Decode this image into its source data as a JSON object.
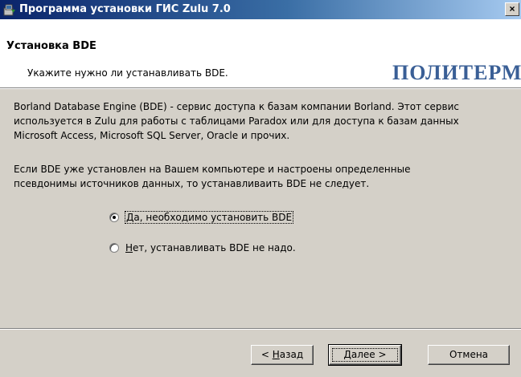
{
  "window": {
    "title": "Программа установки ГИС Zulu 7.0",
    "close_label": "×"
  },
  "header": {
    "title": "Установка BDE",
    "subtitle": "Укажите нужно ли устанавливать BDE.",
    "logo_text": "ПОЛИТЕРМ"
  },
  "content": {
    "paragraph1": "Borland Database Engine (BDE) - сервис доступа к базам компании Borland. Этот сервис используется в Zulu для работы с таблицами Paradox или для доступа к базам данных Microsoft Access, Microsoft SQL Server, Oracle и прочих.",
    "paragraph2": "Если BDE уже установлен на Вашем компьютере и настроены определенные псевдонимы источников данных, то устанавливаить BDE не следует."
  },
  "options": [
    {
      "hotkey": "Д",
      "rest": "а, необходимо установить BDE",
      "checked": true
    },
    {
      "hotkey": "Н",
      "rest": "ет,  устанавливать BDE не надо.",
      "checked": false
    }
  ],
  "buttons": {
    "back_prefix": "< ",
    "back_hotkey": "Н",
    "back_rest": "азад",
    "next_hotkey": "Д",
    "next_rest": "алее >",
    "cancel": "Отмена"
  },
  "colors": {
    "titlebar_start": "#0a246a",
    "titlebar_end": "#a6caf0",
    "logo": "#3a5f96",
    "dialog_bg": "#d4d0c8"
  },
  "icons": {
    "app": "installer-icon",
    "close": "close-icon"
  }
}
